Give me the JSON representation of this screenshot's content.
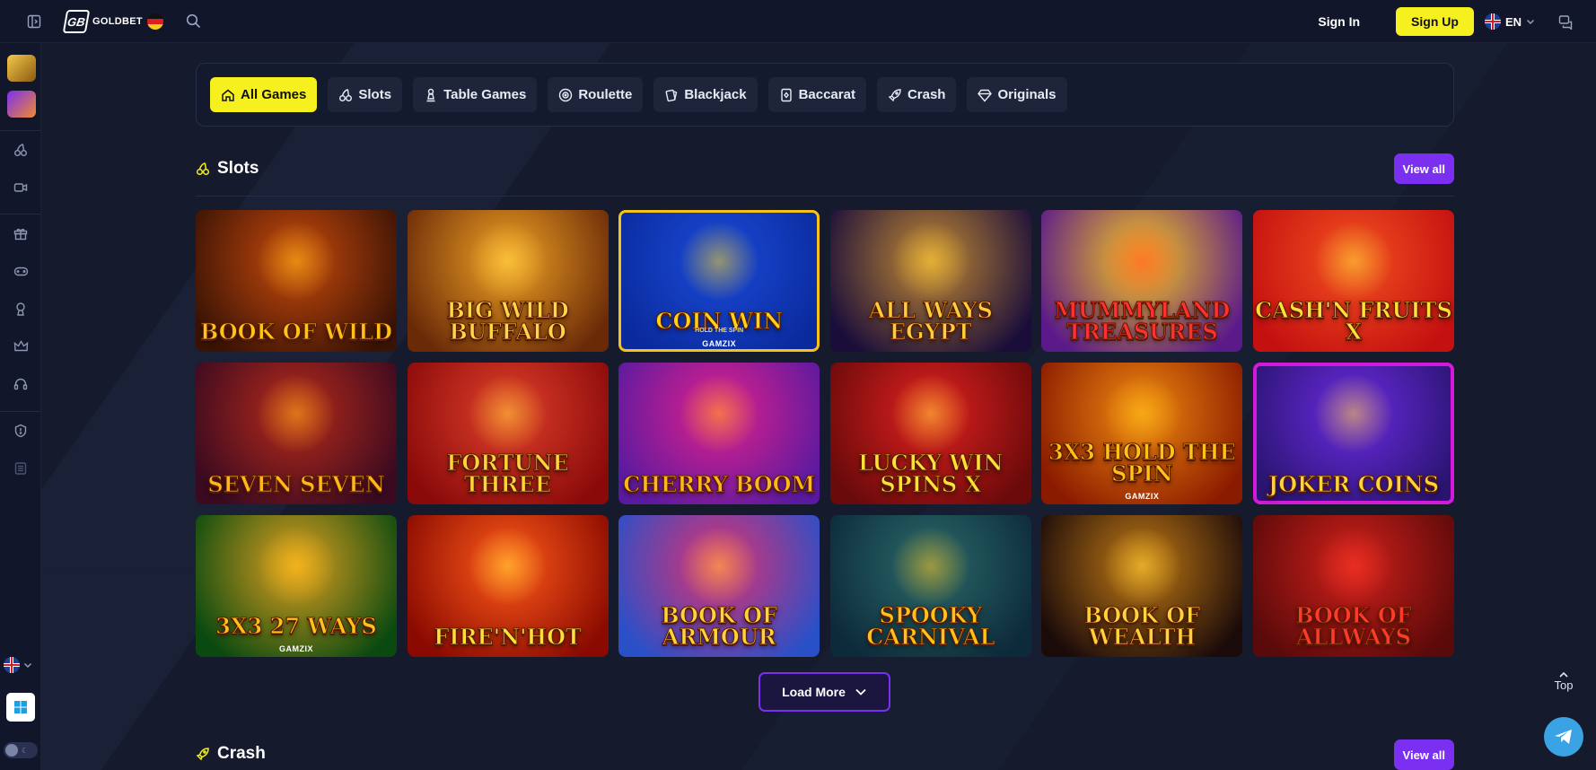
{
  "header": {
    "logo_mark": "GB",
    "logo_text": "GOLDBET",
    "signin_label": "Sign In",
    "signup_label": "Sign Up",
    "language": "EN"
  },
  "categories": [
    {
      "label": "All Games",
      "icon": "home-icon",
      "active": true
    },
    {
      "label": "Slots",
      "icon": "cherry-icon"
    },
    {
      "label": "Table Games",
      "icon": "pawn-icon"
    },
    {
      "label": "Roulette",
      "icon": "roulette-icon"
    },
    {
      "label": "Blackjack",
      "icon": "cards-icon"
    },
    {
      "label": "Baccarat",
      "icon": "card-icon"
    },
    {
      "label": "Crash",
      "icon": "rocket-icon"
    },
    {
      "label": "Originals",
      "icon": "diamond-icon"
    }
  ],
  "sections": {
    "slots": {
      "title": "Slots",
      "view_all": "View all"
    },
    "crash": {
      "title": "Crash",
      "view_all": "View all"
    }
  },
  "games": [
    {
      "title": "Book of Wild",
      "colors": [
        "#3a1305",
        "#c94a0c"
      ],
      "text": "#ffc21a"
    },
    {
      "title": "Big Wild Buffalo",
      "colors": [
        "#6a2a08",
        "#f0a224"
      ],
      "text": "#ffd64a"
    },
    {
      "title": "Coin Win",
      "sub": "HOLD THE SPIN",
      "brand": "GAMZIX",
      "colors": [
        "#0a2a9c",
        "#1a4ad8"
      ],
      "text": "#ffd31a"
    },
    {
      "title": "All Ways Egypt",
      "colors": [
        "#1a0d3a",
        "#c28a34"
      ],
      "text": "#ffcf3a"
    },
    {
      "title": "Mummyland Treasures",
      "colors": [
        "#5a1a8a",
        "#f8c81e"
      ],
      "text": "#ff3030"
    },
    {
      "title": "Cash'n Fruits X",
      "colors": [
        "#c41010",
        "#f25020"
      ],
      "text": "#ffe03a"
    },
    {
      "title": "Seven Seven",
      "colors": [
        "#3a0a20",
        "#b82a1a"
      ],
      "text": "#ffb71a"
    },
    {
      "title": "Fortune Three",
      "colors": [
        "#8a0a0a",
        "#e0402a"
      ],
      "text": "#ffd43a"
    },
    {
      "title": "Cherry Boom",
      "colors": [
        "#5a1aa0",
        "#e0208a"
      ],
      "text": "#ffb81a"
    },
    {
      "title": "Lucky Win Spins X",
      "colors": [
        "#6a0a0a",
        "#e02020"
      ],
      "text": "#ffe03a"
    },
    {
      "title": "3x3 Hold the Spin",
      "brand": "GAMZIX",
      "colors": [
        "#8a1a00",
        "#f08a10"
      ],
      "text": "#ffc21a"
    },
    {
      "title": "Joker Coins",
      "colors": [
        "#2a1470",
        "#6a2ae0"
      ],
      "text": "#ffd43a"
    },
    {
      "title": "3x3 27 Ways",
      "brand": "GAMZIX",
      "colors": [
        "#0a4a10",
        "#e0a020"
      ],
      "text": "#ffc21a"
    },
    {
      "title": "Fire'n'Hot",
      "colors": [
        "#8a0a00",
        "#ff5a1a"
      ],
      "text": "#ffe03a"
    },
    {
      "title": "Book of Armour",
      "colors": [
        "#2a50c8",
        "#e03070"
      ],
      "text": "#ffd43a"
    },
    {
      "title": "Spooky Carnival",
      "colors": [
        "#0d2a3a",
        "#2a6a6a"
      ],
      "text": "#ffc21a"
    },
    {
      "title": "Book of Wealth",
      "colors": [
        "#1a0a0a",
        "#c27a14"
      ],
      "text": "#ffd43a"
    },
    {
      "title": "Book of Allways",
      "colors": [
        "#5a0a0a",
        "#d0201a"
      ],
      "text": "#ff3a2a"
    }
  ],
  "load_more_label": "Load More",
  "top_label": "Top",
  "accent": "#f6f01e",
  "purple": "#7b2ff0"
}
